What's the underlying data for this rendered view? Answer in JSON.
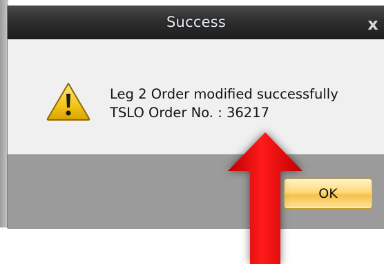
{
  "dialog": {
    "title": "Success",
    "close_glyph": "x",
    "message_line1": "Leg 2 Order modified successfully",
    "message_line2": "TSLO Order No. : 36217",
    "ok_label": "OK"
  },
  "icons": {
    "dialog_icon": "warning-icon",
    "annotation": "red-arrow-icon"
  },
  "colors": {
    "titlebar": "#2f2f2f",
    "title_text": "#e6edf5",
    "content_bg": "#f0f0f0",
    "footer_bg": "#9b9b9b",
    "ok_button": "#f6c04a",
    "arrow": "#e00000"
  }
}
